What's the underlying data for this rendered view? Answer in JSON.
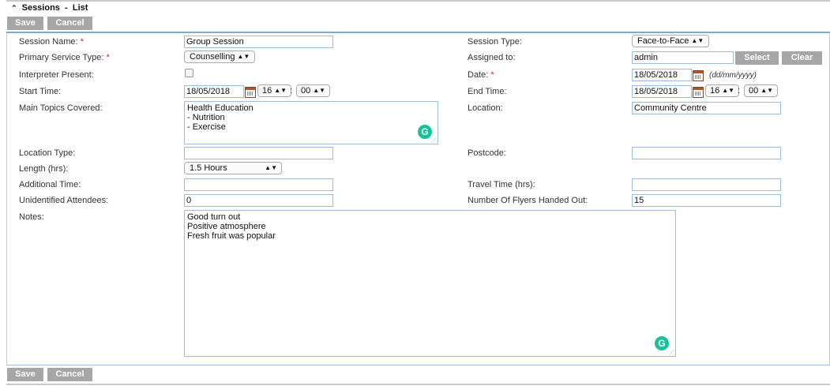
{
  "header": {
    "chevron_icon": "double-chevron-up-icon",
    "breadcrumb_title": "Sessions",
    "breadcrumb_sep": "-",
    "breadcrumb_link": "List"
  },
  "toolbar": {
    "save_label": "Save",
    "cancel_label": "Cancel"
  },
  "form": {
    "session_name": {
      "label": "Session Name:",
      "required": "*",
      "value": "Group Session"
    },
    "session_type": {
      "label": "Session Type:",
      "value": "Face-to-Face"
    },
    "primary_service_type": {
      "label": "Primary Service Type:",
      "required": "*",
      "value": "Counselling"
    },
    "assigned_to": {
      "label": "Assigned to:",
      "value": "admin",
      "select_label": "Select",
      "clear_label": "Clear"
    },
    "interpreter_present": {
      "label": "Interpreter Present:",
      "checked": false
    },
    "date": {
      "label": "Date:",
      "required": "*",
      "value": "18/05/2018",
      "format_hint": "(dd/mm/yyyy)"
    },
    "start_time": {
      "label": "Start Time:",
      "date": "18/05/2018",
      "hour": "16",
      "minute": "00"
    },
    "end_time": {
      "label": "End Time:",
      "date": "18/05/2018",
      "hour": "16",
      "minute": "00"
    },
    "time_separator": ":",
    "main_topics": {
      "label": "Main Topics Covered:",
      "lines": [
        "Health Education",
        "- Nutrition",
        "- Exercise"
      ]
    },
    "location": {
      "label": "Location:",
      "value": "Community Centre"
    },
    "location_type": {
      "label": "Location Type:",
      "value": ""
    },
    "postcode": {
      "label": "Postcode:",
      "value": ""
    },
    "length": {
      "label": "Length (hrs):",
      "value": "1.5 Hours"
    },
    "additional_time": {
      "label": "Additional Time:",
      "value": ""
    },
    "travel_time": {
      "label": "Travel Time (hrs):",
      "value": ""
    },
    "unidentified_attendees": {
      "label": "Unidentified Attendees:",
      "value": "0"
    },
    "flyers": {
      "label": "Number Of Flyers Handed Out:",
      "value": "15"
    },
    "notes": {
      "label": "Notes:",
      "lines": [
        "Good turn out",
        "Positive atmosphere",
        "Fresh fruit was popular"
      ]
    }
  },
  "icons": {
    "calendar": "calendar-icon",
    "grammarly": "grammarly-icon",
    "grammarly_glyph": "G",
    "select_arrow": "updown-arrows-icon",
    "select_arrow_glyph": "▲▼",
    "resize": "resize-grip-icon"
  },
  "colors": {
    "accent_bar": "#7fa9cf",
    "button_gray": "#a6a6a6",
    "required": "#d22222",
    "grammarly": "#15c39a"
  }
}
